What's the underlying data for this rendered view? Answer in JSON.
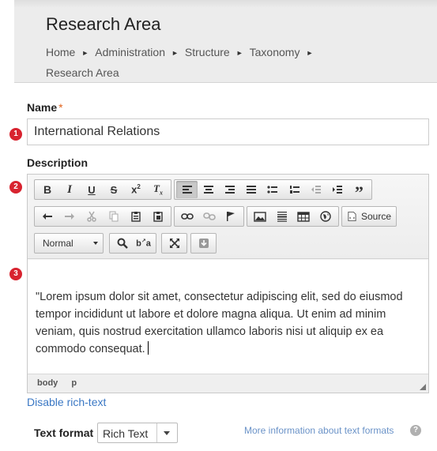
{
  "header": {
    "title": "Research Area",
    "breadcrumb": [
      "Home",
      "Administration",
      "Structure",
      "Taxonomy",
      "Research Area"
    ]
  },
  "form": {
    "name_label": "Name",
    "required_mark": "*",
    "name_value": "International Relations",
    "description_label": "Description",
    "markers": [
      "1",
      "2",
      "3"
    ]
  },
  "editor": {
    "toolbar": {
      "row1": [
        "bold-icon",
        "italic-icon",
        "underline-icon",
        "strikethrough-icon",
        "superscript-icon",
        "remove-format-icon",
        "align-left-icon",
        "align-center-icon",
        "align-right-icon",
        "justify-icon",
        "bulleted-list-icon",
        "numbered-list-icon",
        "outdent-icon",
        "indent-icon",
        "blockquote-icon"
      ],
      "row2": [
        "undo-icon",
        "redo-icon",
        "cut-icon",
        "copy-icon",
        "paste-icon",
        "paste-text-icon",
        "link-icon",
        "unlink-icon",
        "anchor-flag-icon",
        "image-icon",
        "horizontal-line-icon",
        "table-icon",
        "globe-icon",
        "source-icon"
      ],
      "source_label": "Source",
      "format_value": "Normal"
    },
    "content": "\"Lorem ipsum dolor sit amet, consectetur adipiscing elit, sed do eiusmod tempor incididunt ut labore et dolore magna aliqua. Ut enim ad minim veniam, quis nostrud exercitation ullamco laboris nisi ut aliquip ex ea commodo consequat.",
    "status_path": [
      "body",
      "p"
    ]
  },
  "disable_rich_text": "Disable rich-text",
  "text_format": {
    "label": "Text format",
    "value": "Rich Text",
    "more_info": "More information about text formats",
    "help": "?"
  },
  "colors": {
    "marker": "#d8232f",
    "link": "#3b78c4",
    "required": "#e0641e"
  }
}
